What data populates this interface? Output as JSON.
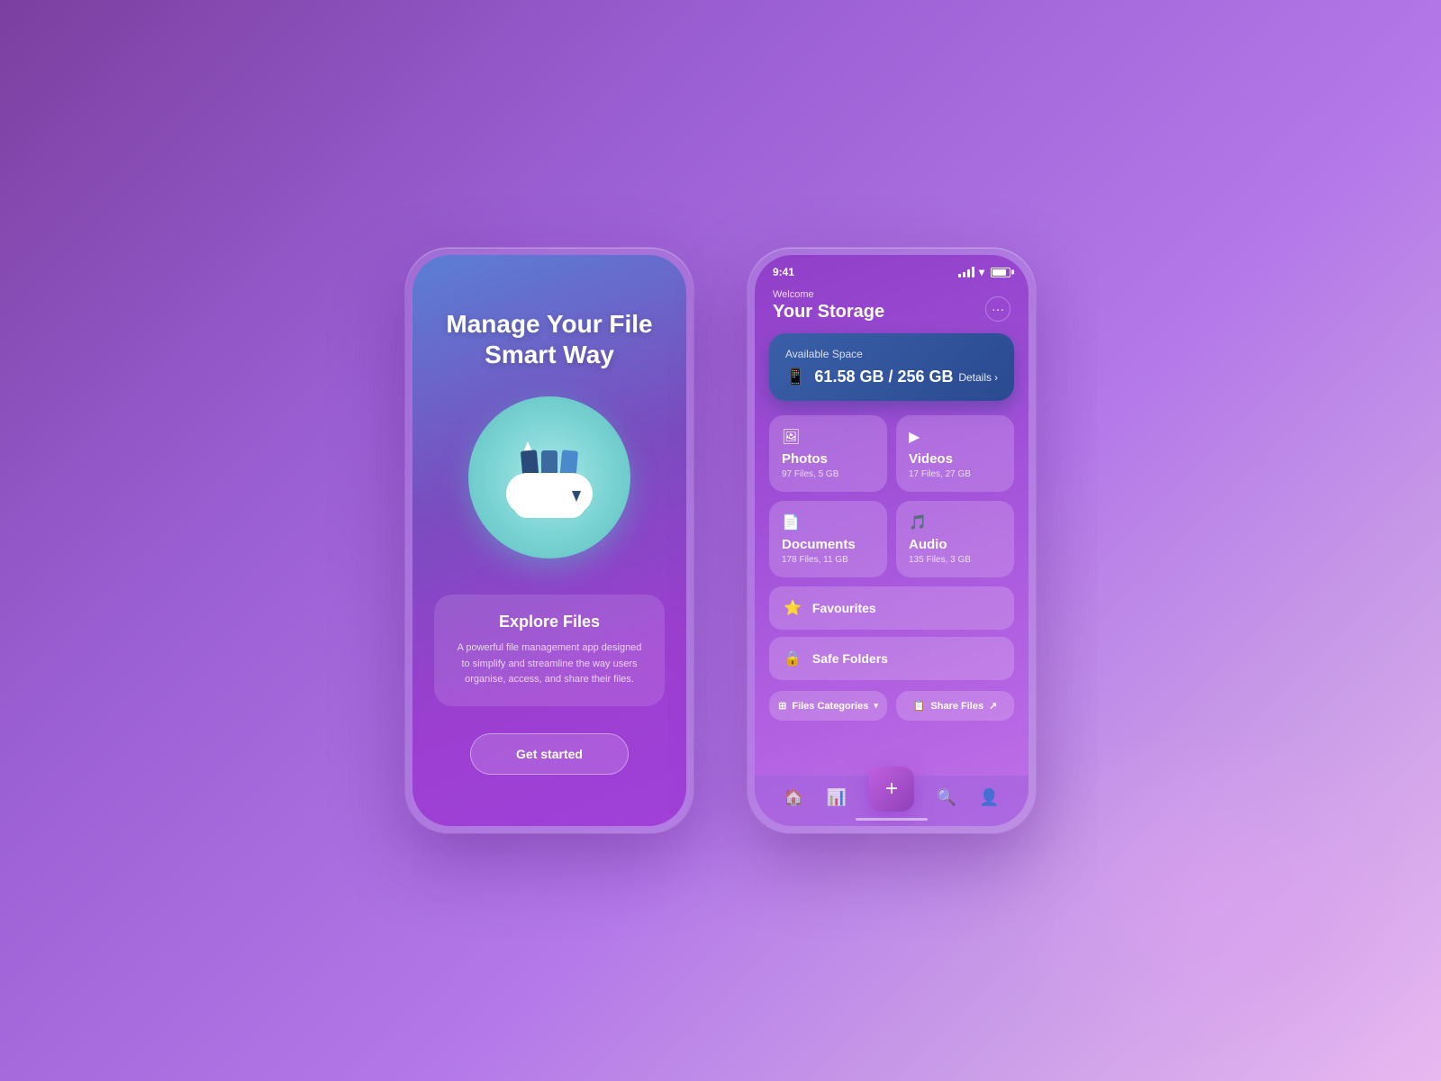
{
  "background": {
    "color_start": "#7b3fa0",
    "color_end": "#e8b8f0"
  },
  "phone1": {
    "title": "Manage Your File Smart Way",
    "info_box": {
      "title": "Explore Files",
      "description": "A powerful file management app designed to simplify and streamline the way users organise, access, and share their files."
    },
    "cta_button": "Get started"
  },
  "phone2": {
    "status_bar": {
      "time": "9:41",
      "signal": "4 bars",
      "wifi": "on",
      "battery": "75%"
    },
    "header": {
      "welcome": "Welcome",
      "title": "Your Storage",
      "more_label": "···"
    },
    "space_card": {
      "label": "Available Space",
      "amount": "61.58 GB / 256 GB",
      "details_label": "Details"
    },
    "categories": [
      {
        "icon": "🖼",
        "name": "Photos",
        "meta": "97 Files, 5 GB"
      },
      {
        "icon": "▶",
        "name": "Videos",
        "meta": "17 Files, 27 GB"
      },
      {
        "icon": "📄",
        "name": "Documents",
        "meta": "178 Files, 11 GB"
      },
      {
        "icon": "🎵",
        "name": "Audio",
        "meta": "135 Files, 3 GB"
      }
    ],
    "list_items": [
      {
        "icon": "⭐",
        "label": "Favourites"
      },
      {
        "icon": "🔒",
        "label": "Safe Folders"
      }
    ],
    "action_buttons": [
      {
        "icon": "⊞",
        "label": "Files Categories"
      },
      {
        "icon": "📋",
        "label": "Share Files"
      }
    ],
    "bottom_nav": [
      {
        "icon": "🏠",
        "label": "Home"
      },
      {
        "icon": "📊",
        "label": "Stats"
      },
      {
        "icon": "+",
        "label": "",
        "is_fab": true
      },
      {
        "icon": "🔍",
        "label": "Search"
      },
      {
        "icon": "👤",
        "label": "Profile"
      }
    ]
  }
}
